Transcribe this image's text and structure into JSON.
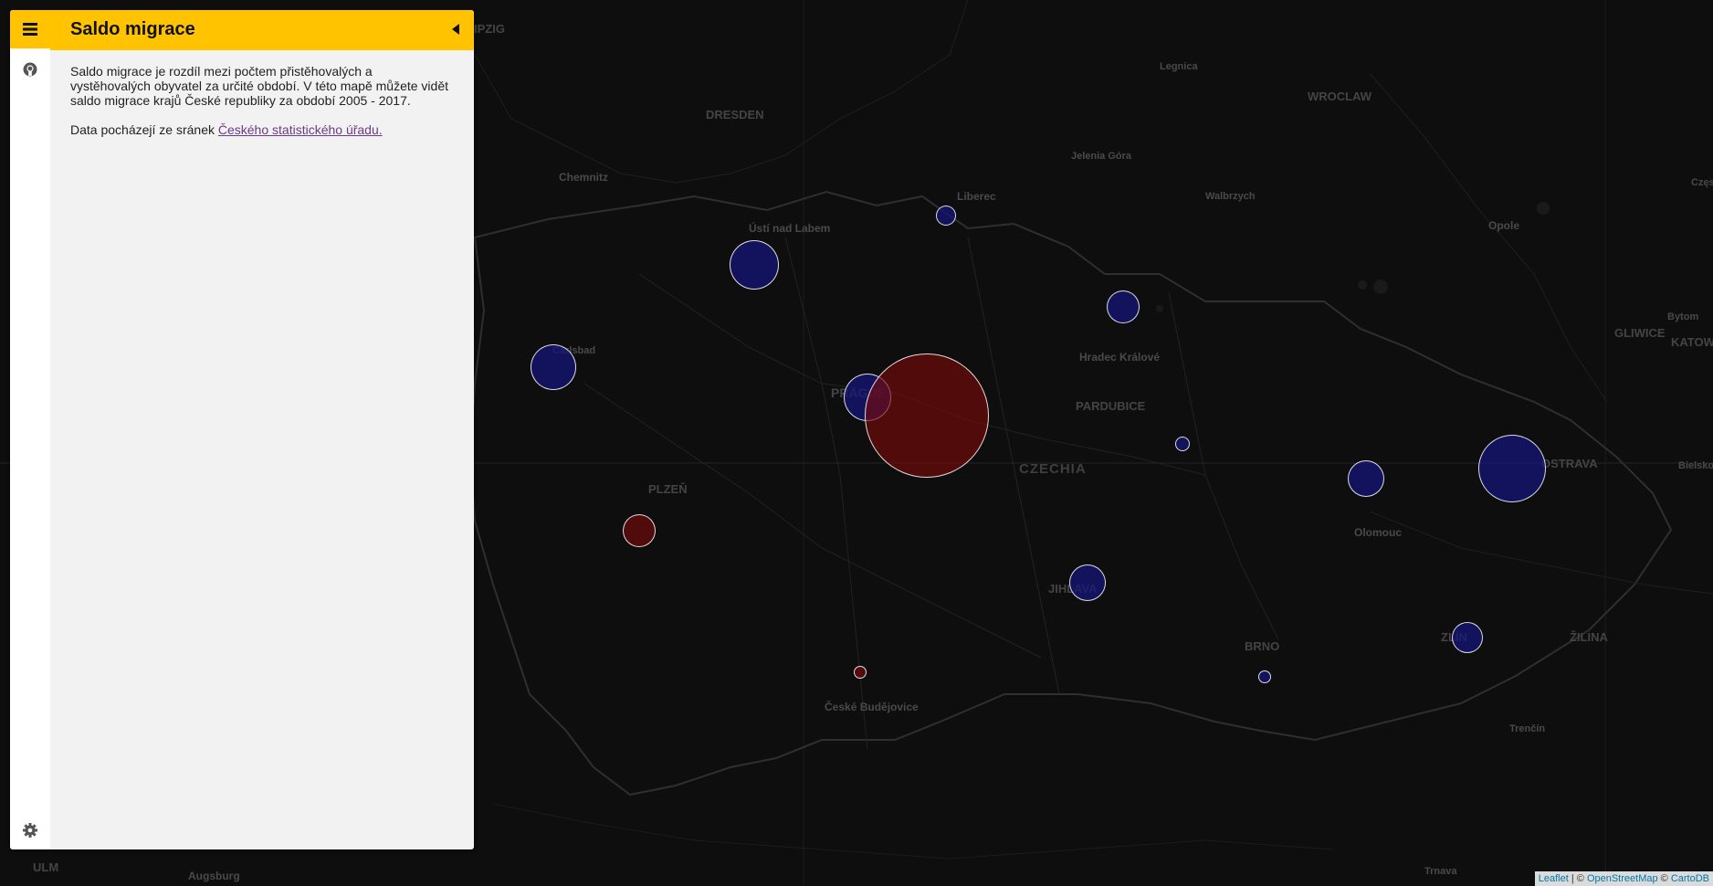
{
  "sidebar": {
    "title": "Saldo migrace",
    "description": "Saldo migrace je rozdíl mezi počtem přistěhovalých a vystěhovalých obyvatel za určité období. V této mapě můžete vidět saldo migrace krajů České republiky za období 2005 - 2017.",
    "source_prefix": "Data pocházejí ze sránek ",
    "source_link": "Českého statistického úřadu.",
    "tabs": [
      "menu-icon",
      "github-icon",
      "gear-icon"
    ]
  },
  "map": {
    "labels": {
      "leipzig": "IPZIG",
      "dresden": "DRESDEN",
      "chemnitz": "Chemnitz",
      "usti": "Ústí nad Labem",
      "liberec": "Liberec",
      "legnica": "Legnica",
      "wroclaw": "WROCLAW",
      "jelenia": "Jelenia Góra",
      "walbrzych": "Walbrzych",
      "opole": "Opole",
      "czest": "Często",
      "gliwice": "GLIWICE",
      "bytom": "Bytom",
      "katowice": "KATOW",
      "karlovy": "Carlsbad",
      "prague": "PRAGUE",
      "hradec": "Hradec Králové",
      "pardubice": "PARDUBICE",
      "czechia": "CZECHIA",
      "plzen": "PLZEŇ",
      "ostrava": "OSTRAVA",
      "bielsko": "Bielsko",
      "olomouc": "Olomouc",
      "jihlava": "JIHLAVA",
      "brno": "BRNO",
      "zlin": "ZLÍN",
      "zilina": "ŽILINA",
      "budejovice": "České Budějovice",
      "trencin": "Trenčín",
      "ulm": "ULM",
      "augsburg": "Augsburg",
      "trnava": "Trnava"
    },
    "colors": {
      "positive": "#141478",
      "negative": "#780a0a",
      "accent": "#ffc300"
    }
  },
  "attribution": {
    "leaflet": "Leaflet",
    "sep1": " | © ",
    "osm": "OpenStreetMap",
    "sep2": " © ",
    "carto": "CartoDB"
  }
}
